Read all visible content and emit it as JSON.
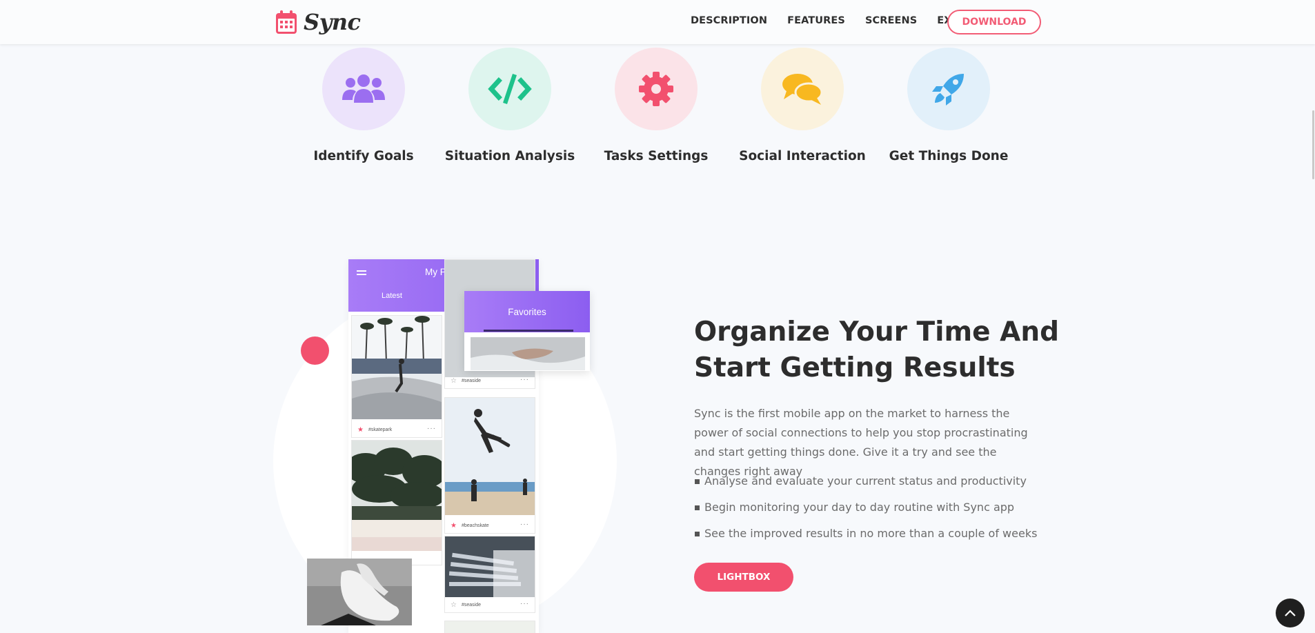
{
  "brand": {
    "name": "Sync",
    "icon": "calendar-icon",
    "color": "#f2506e"
  },
  "nav": {
    "links": [
      "DESCRIPTION",
      "FEATURES",
      "SCREENS",
      "EXTRA"
    ],
    "download_label": "DOWNLOAD"
  },
  "features": [
    {
      "title": "Identify Goals",
      "icon": "users-icon",
      "color": "#9b6ef0",
      "bg": "#ece3fb"
    },
    {
      "title": "Situation Analysis",
      "icon": "code-icon",
      "color": "#1ec28b",
      "bg": "#def5ee"
    },
    {
      "title": "Tasks Settings",
      "icon": "gear-icon",
      "color": "#f2506e",
      "bg": "#fbe3e8"
    },
    {
      "title": "Social Interaction",
      "icon": "comments-icon",
      "color": "#f8b820",
      "bg": "#fbf2dd"
    },
    {
      "title": "Get Things Done",
      "icon": "rocket-icon",
      "color": "#40a7e8",
      "bg": "#e2f0fa"
    }
  ],
  "mockup": {
    "phone_title": "My Picks",
    "tab_latest": "Latest",
    "favorites_title": "Favorites",
    "tags": [
      "#skatepark",
      "#seaside",
      "#beachskate",
      "#seaside"
    ]
  },
  "hero": {
    "title": "Organize Your Time And Start Getting Results",
    "description": "Sync is the first mobile app on the market to harness the power of social connections to help you stop procrastinating and start getting things done. Give it a try and see the changes right away",
    "bullets": [
      "Analyse and evaluate your current status and productivity",
      "Begin monitoring your day to day routine with Sync app",
      "See the improved results in no more than a couple of weeks"
    ],
    "button_label": "LIGHTBOX"
  }
}
